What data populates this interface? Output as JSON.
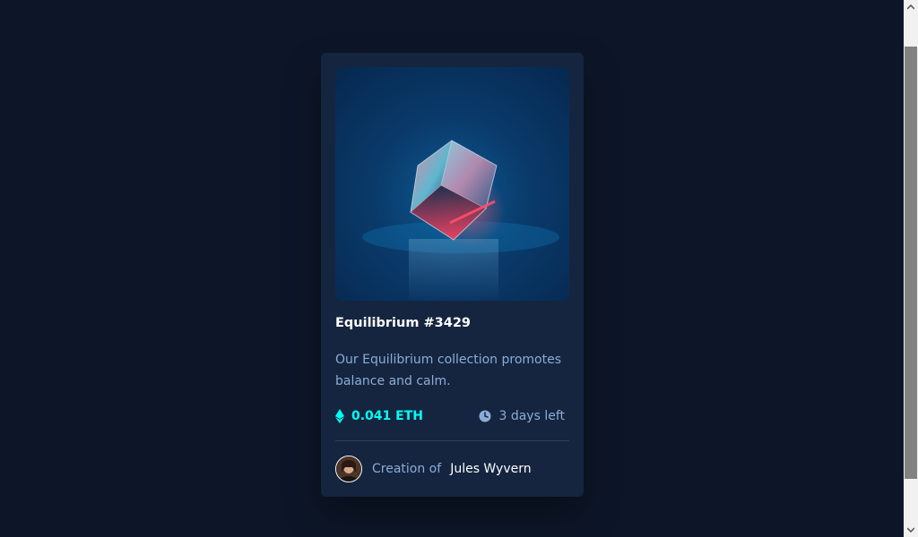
{
  "card": {
    "image_alt": "Equilibrium cube",
    "title": "Equilibrium #3429",
    "description": "Our Equilibrium collection promotes balance and calm.",
    "price": "0.041 ETH",
    "time_left": "3 days left",
    "creation_prefix": "Creation of",
    "creator_name": "Jules Wyvern"
  },
  "icons": {
    "price": "ethereum-icon",
    "time": "clock-icon",
    "avatar": "creator-avatar"
  },
  "colors": {
    "page_bg": "#0d1628",
    "card_bg": "#15253f",
    "accent_cyan": "#00fff8",
    "soft_blue": "#8bacd9",
    "white": "#ffffff"
  }
}
